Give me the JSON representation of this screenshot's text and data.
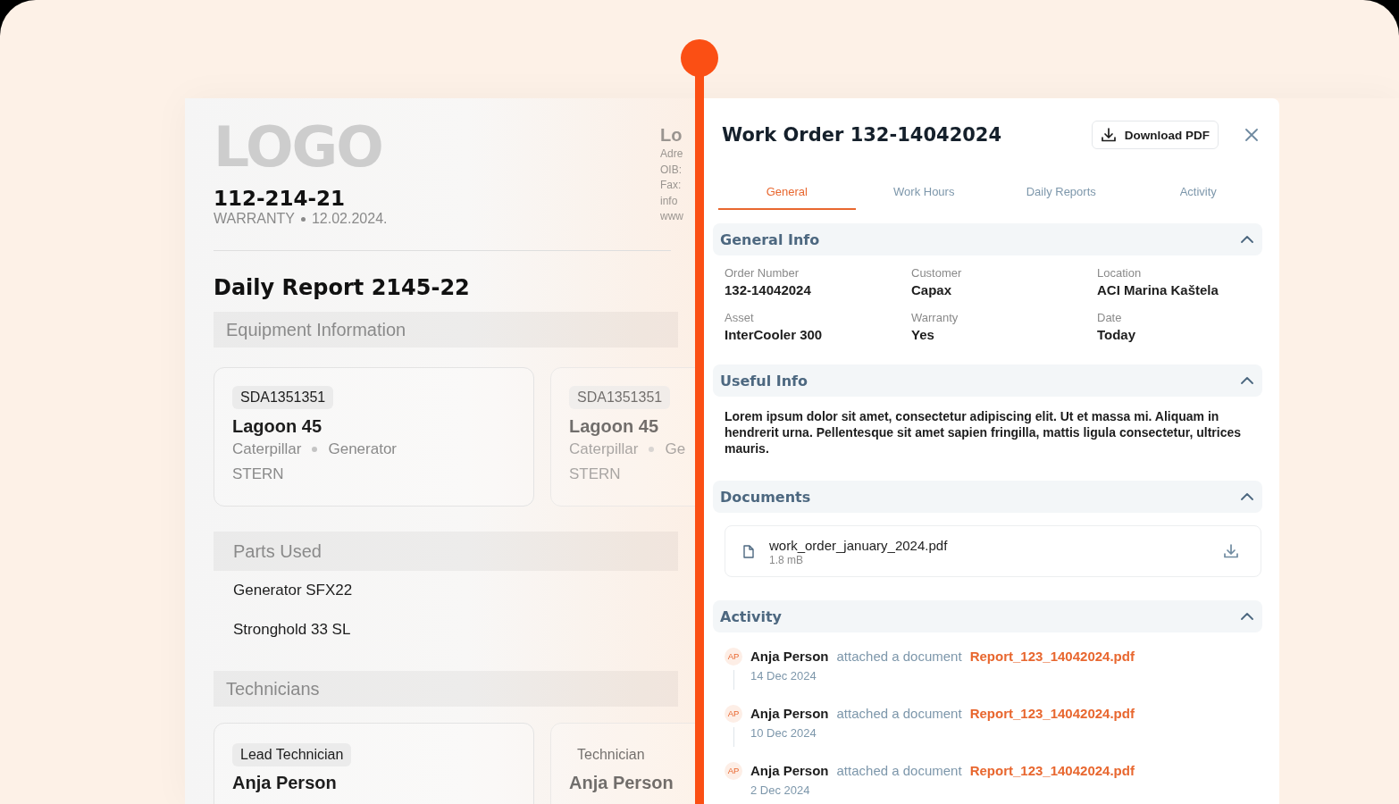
{
  "report_document": {
    "logo": "LOGO",
    "number": "112-214-21",
    "type": "WARRANTY",
    "date": "12.02.2024.",
    "company_info": [
      "Lo",
      "Adre",
      "OIB:",
      "Fax:",
      "info",
      "www"
    ],
    "title": "Daily Report 2145-22",
    "sections": [
      {
        "kind": "equipment",
        "heading": "Equipment Information",
        "cards": [
          {
            "code": "SDA1351351",
            "name": "Lagoon 45",
            "brand": "Caterpillar",
            "type": "Generator",
            "position": "STERN"
          },
          {
            "code": "SDA1351351",
            "name": "Lagoon 45",
            "brand": "Caterpillar",
            "type": "Ge",
            "position": "STERN"
          }
        ]
      },
      {
        "kind": "parts",
        "heading": "Parts Used",
        "items": [
          "Generator SFX22",
          "Stronghold 33 SL"
        ]
      },
      {
        "kind": "technicians",
        "heading": "Technicians",
        "cards": [
          {
            "role": "Lead Technician",
            "name": "Anja Person"
          },
          {
            "role": "Technician",
            "name": "Anja Person"
          }
        ]
      }
    ]
  },
  "work_order": {
    "title": "Work Order 132-14042024",
    "download_button": "Download PDF",
    "tabs": [
      {
        "label": "General",
        "selected": true
      },
      {
        "label": "Work Hours",
        "selected": false
      },
      {
        "label": "Daily Reports",
        "selected": false
      },
      {
        "label": "Activity",
        "selected": false
      }
    ],
    "sections": [
      {
        "kind": "fields",
        "heading": "General Info",
        "expanded": true,
        "fields": [
          {
            "label": "Order Number",
            "value": "132-14042024"
          },
          {
            "label": "Customer",
            "value": "Capax"
          },
          {
            "label": "Location",
            "value": "ACI Marina Kaštela"
          },
          {
            "label": "Asset",
            "value": "InterCooler 300"
          },
          {
            "label": "Warranty",
            "value": "Yes"
          },
          {
            "label": "Date",
            "value": "Today"
          }
        ]
      },
      {
        "kind": "text",
        "heading": "Useful Info",
        "expanded": true,
        "text": "Lorem ipsum dolor sit amet, consectetur adipiscing elit. Ut et massa mi. Aliquam in hendrerit urna. Pellentesque sit amet sapien fringilla, mattis ligula consectetur, ultrices mauris."
      },
      {
        "kind": "documents",
        "heading": "Documents",
        "expanded": true,
        "documents": [
          {
            "name": "work_order_january_2024.pdf",
            "size": "1.8 mB"
          }
        ]
      },
      {
        "kind": "activity",
        "heading": "Activity",
        "expanded": true,
        "entries": [
          {
            "initials": "AP",
            "person": "Anja Person",
            "action": "attached a document",
            "document": "Report_123_14042024.pdf",
            "date": "14 Dec 2024"
          },
          {
            "initials": "AP",
            "person": "Anja Person",
            "action": "attached a document",
            "document": "Report_123_14042024.pdf",
            "date": "10 Dec 2024"
          },
          {
            "initials": "AP",
            "person": "Anja Person",
            "action": "attached a document",
            "document": "Report_123_14042024.pdf",
            "date": "2 Dec 2024"
          }
        ]
      }
    ]
  }
}
